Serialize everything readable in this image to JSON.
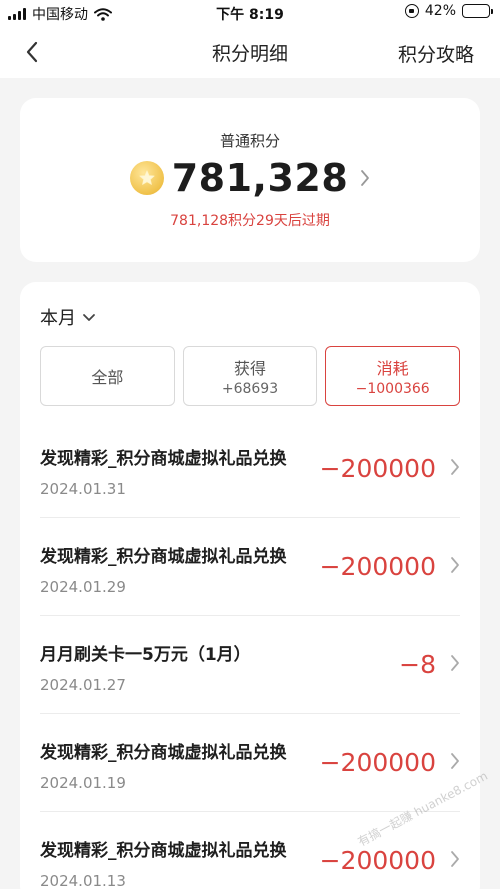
{
  "status_bar": {
    "carrier": "中国移动",
    "time": "下午 8:19",
    "battery_percent": "42%",
    "battery_level": 0.42
  },
  "navbar": {
    "title": "积分明细",
    "right_link": "积分攻略"
  },
  "points_card": {
    "label": "普通积分",
    "value": "781,328",
    "expire_note": "781,128积分29天后过期"
  },
  "filter": {
    "month": "本月",
    "tabs": [
      {
        "label": "全部",
        "sub": ""
      },
      {
        "label": "获得",
        "sub": "+68693"
      },
      {
        "label": "消耗",
        "sub": "−1000366"
      }
    ],
    "active_tab": "消耗"
  },
  "records": [
    {
      "title": "发现精彩_积分商城虚拟礼品兑换",
      "date": "2024.01.31",
      "amount": "−200000"
    },
    {
      "title": "发现精彩_积分商城虚拟礼品兑换",
      "date": "2024.01.29",
      "amount": "−200000"
    },
    {
      "title": "月月刷关卡一5万元（1月）",
      "date": "2024.01.27",
      "amount": "−8"
    },
    {
      "title": "发现精彩_积分商城虚拟礼品兑换",
      "date": "2024.01.19",
      "amount": "−200000"
    },
    {
      "title": "发现精彩_积分商城虚拟礼品兑换",
      "date": "2024.01.13",
      "amount": "−200000"
    }
  ],
  "watermark": "有搞一起赚 huanke8.com",
  "colors": {
    "accent_red": "#d9433f",
    "coin_gold": "#f0c24b",
    "background": "#f4f4f4"
  }
}
